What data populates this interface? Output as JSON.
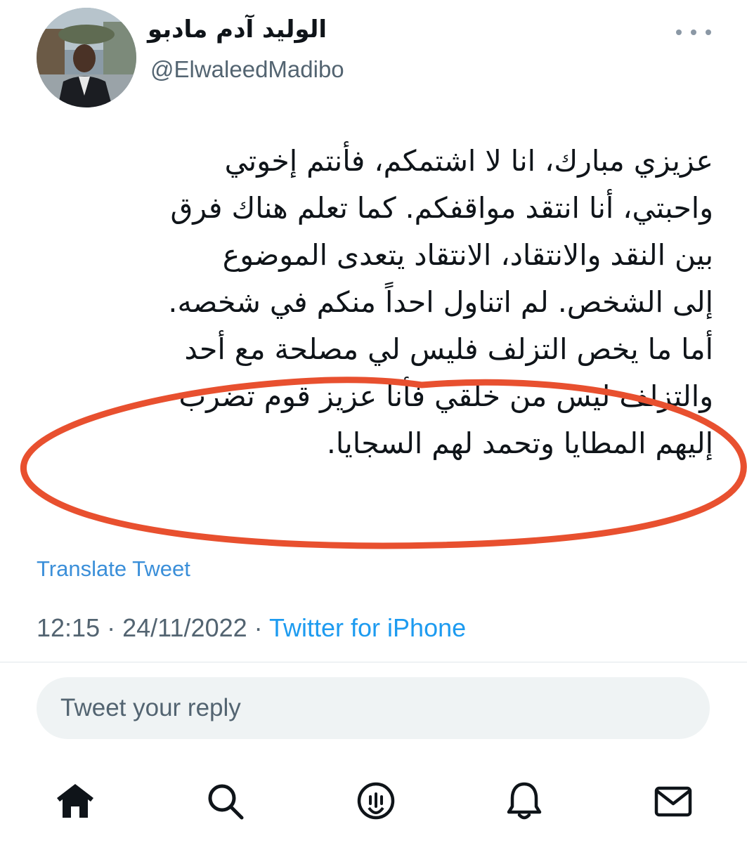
{
  "tweet": {
    "author": {
      "display_name": "الوليد آدم مادبو",
      "handle": "@ElwaleedMadibo"
    },
    "text_lines": [
      "عزيزي مبارك، انا لا اشتمكم، فأنتم إخوتي",
      "واحبتي، أنا انتقد مواقفكم. كما تعلم هناك فرق",
      "بين النقد والانتقاد، الانتقاد يتعدى الموضوع",
      "إلى الشخص. لم اتناول احداً منكم في شخصه.",
      "أما ما يخص التزلف فليس لي مصلحة مع أحد",
      "والتزلف ليس من خلقي فأنا عزيز قوم تضرب",
      "إليهم المطايا وتحمد لهم السجايا."
    ],
    "translate_label": "Translate Tweet",
    "time": "12:15",
    "separator": "·",
    "date": "24/11/2022",
    "source": "Twitter for iPhone"
  },
  "reply": {
    "placeholder": "Tweet your reply"
  },
  "annotation": {
    "color": "#e8502f"
  },
  "tabbar": {
    "items": [
      "home-icon",
      "search-icon",
      "spaces-icon",
      "notifications-icon",
      "messages-icon"
    ]
  }
}
